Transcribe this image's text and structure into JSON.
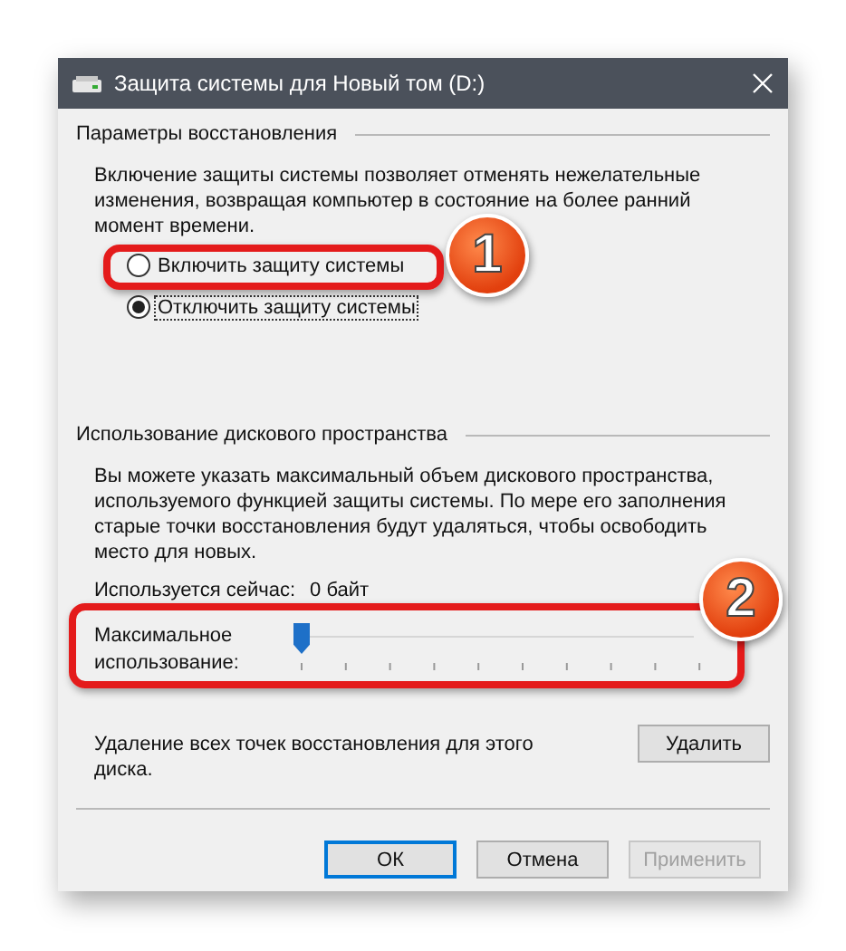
{
  "window": {
    "title": "Защита системы для Новый том (D:)"
  },
  "restore_settings": {
    "heading": "Параметры восстановления",
    "description": "Включение защиты системы позволяет отменять нежелательные изменения, возвращая компьютер в состояние на более ранний момент времени.",
    "options": [
      {
        "label": "Включить защиту системы",
        "selected": false
      },
      {
        "label": "Отключить защиту системы",
        "selected": true
      }
    ]
  },
  "disk_usage": {
    "heading": "Использование дискового пространства",
    "description": "Вы можете указать максимальный объем дискового пространства, используемого функцией защиты системы. По мере его заполнения старые точки восстановления будут удаляться, чтобы освободить место для новых.",
    "current_label": "Используется сейчас:",
    "current_value": "0 байт",
    "max_label": "Максимальное использование:",
    "max_usage": {
      "level": 0
    }
  },
  "delete": {
    "text": "Удаление всех точек восстановления для этого диска.",
    "button": "Удалить"
  },
  "buttons": [
    {
      "label": "ОК",
      "default": true,
      "disabled": false
    },
    {
      "label": "Отмена",
      "default": false,
      "disabled": false
    },
    {
      "label": "Применить",
      "default": false,
      "disabled": true
    }
  ],
  "callouts": [
    {
      "number": "1"
    },
    {
      "number": "2"
    }
  ]
}
